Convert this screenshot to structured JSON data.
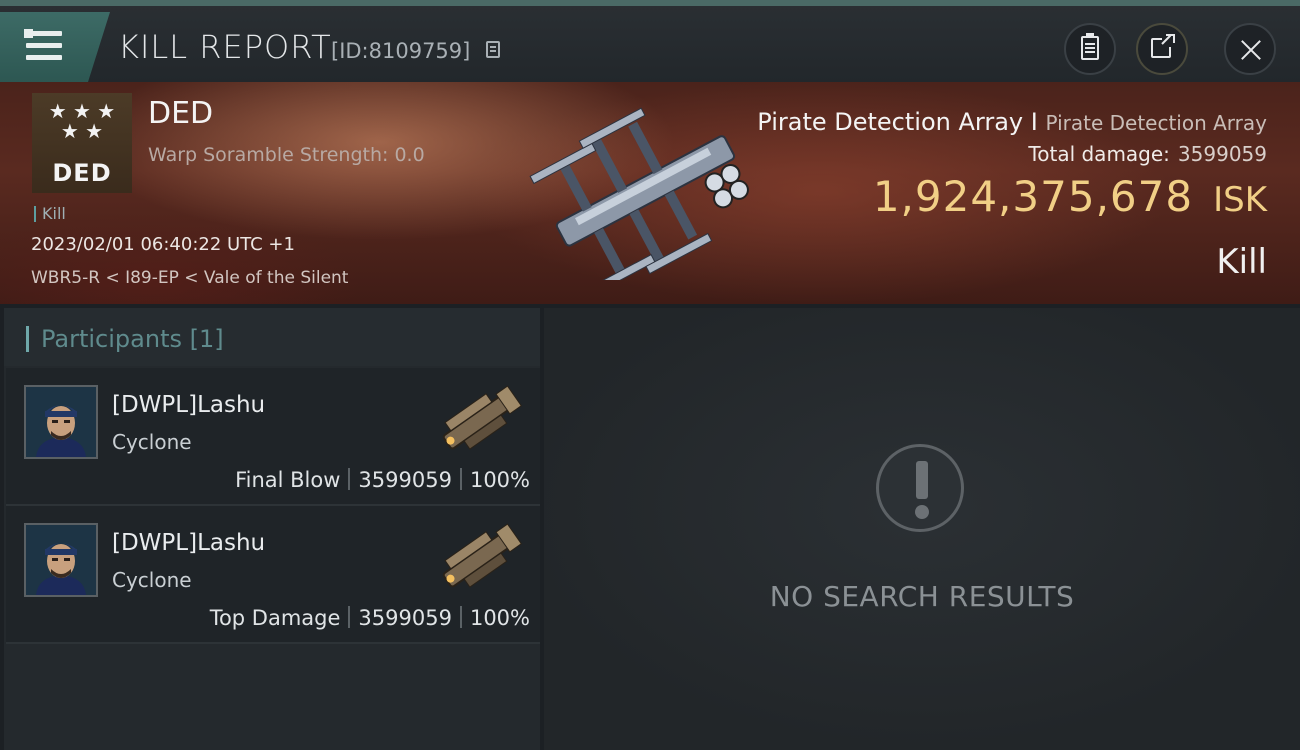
{
  "header": {
    "title": "KILL REPORT",
    "report_id": "[ID:8109759]",
    "icons": {
      "menu": "menu-icon",
      "copy": "copy-icon",
      "clipboard": "clipboard-icon",
      "share": "share-icon",
      "close": "close-icon"
    }
  },
  "victim": {
    "corp_name": "DED",
    "logo_text": "DED",
    "scramble": "Warp Soramble Strength: 0.0",
    "tag": "Kill",
    "datetime": "2023/02/01 06:40:22 UTC +1",
    "location": "WBR5-R < I89-EP < Vale of the Silent",
    "target_name": "Pirate Detection Array I",
    "target_type": "Pirate Detection Array",
    "total_damage_label": "Total damage:",
    "total_damage": "3599059",
    "isk_value": "1,924,375,678",
    "isk_unit": "ISK",
    "kill_type": "Kill"
  },
  "participants": {
    "title": "Participants",
    "count": "[1]",
    "rows": [
      {
        "name": "[DWPL]Lashu",
        "ship": "Cyclone",
        "label": "Final Blow",
        "damage": "3599059",
        "percent": "100%"
      },
      {
        "name": "[DWPL]Lashu",
        "ship": "Cyclone",
        "label": "Top Damage",
        "damage": "3599059",
        "percent": "100%"
      }
    ]
  },
  "right_panel": {
    "empty_text": "NO SEARCH RESULTS"
  },
  "colors": {
    "accent_teal": "#4a6a66",
    "isk_gold": "#f1cf86"
  }
}
